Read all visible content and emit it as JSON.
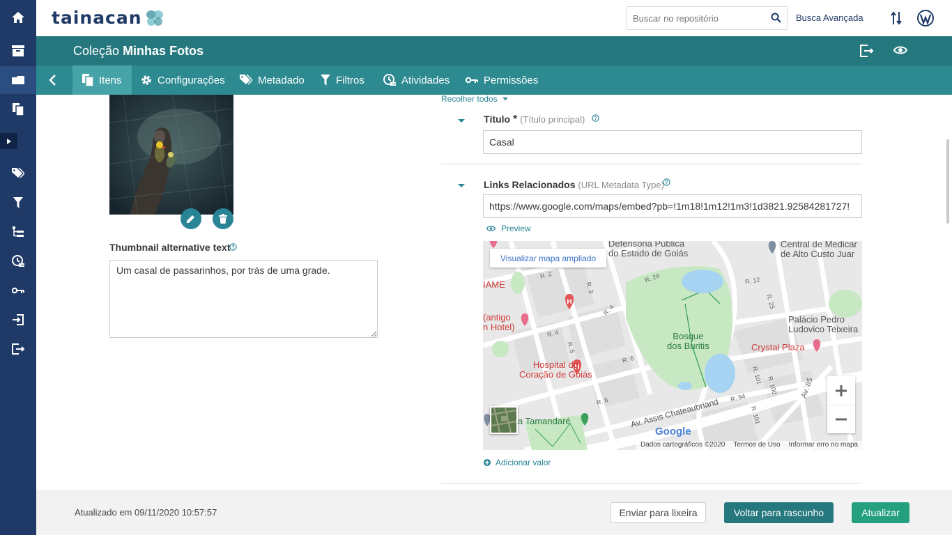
{
  "header": {
    "logo_text": "Tainacan",
    "search_placeholder": "Buscar no repositório",
    "advanced_search": "Busca Avançada"
  },
  "collection": {
    "prefix": "Coleção",
    "name": "Minhas Fotos"
  },
  "tabs": [
    {
      "label": "Itens",
      "icon": "items-icon",
      "active": true
    },
    {
      "label": "Configurações",
      "icon": "gear-icon",
      "active": false
    },
    {
      "label": "Metadado",
      "icon": "tag-icon",
      "active": false
    },
    {
      "label": "Filtros",
      "icon": "filter-icon",
      "active": false
    },
    {
      "label": "Atividades",
      "icon": "activity-icon",
      "active": false
    },
    {
      "label": "Permissões",
      "icon": "key-icon",
      "active": false
    }
  ],
  "sidebar_icons": [
    "home-icon",
    "archive-icon",
    "collections-icon",
    "items-icon",
    "expand-icon",
    "tag-icon",
    "filter-icon",
    "taxonomy-icon",
    "activity-icon",
    "key-icon",
    "import-icon",
    "export-icon"
  ],
  "thumbnail": {
    "alt_label": "Thumbnail alternative text",
    "alt_value": "Um casal de passarinhos, por trás de uma grade."
  },
  "form": {
    "collapse_all": "Recolher todos",
    "title_field": {
      "label": "Título",
      "required_mark": "*",
      "sub": "(Título principal)",
      "value": "Casal"
    },
    "links_field": {
      "label": "Links Relacionados",
      "sub": "(URL Metadata Type)",
      "value": "https://www.google.com/maps/embed?pb=!1m18!1m12!1m3!1d3821.92584281727!"
    },
    "preview": "Preview",
    "add_value": "Adicionar valor"
  },
  "map": {
    "enlarge": "Visualizar mapa ampliado",
    "labels": {
      "defensoria": "Defensoria Pública\ndo Estado de Goiás",
      "central": "Central de Medicar\nde Alto Custo Juar",
      "iame": "IAME",
      "antigo": "(antigo\nn Hotel)",
      "bosque": "Bosque\ndos Buritis",
      "palacio": "Palácio Pedro\nLudovico Teixeira",
      "crystal": "Crystal Plaza",
      "hospital": "Hospital do\nCoração de Goiás",
      "tamandare": "a Tamandaré",
      "avenue": "Av. Assis Chateaubriand"
    },
    "roads": [
      "R. 2",
      "R. 3",
      "R. 29",
      "R. 12",
      "R. 25",
      "R. 4",
      "R. 5",
      "R. 6",
      "R. 8",
      "R. 94",
      "R. 101",
      "R. 100",
      "Av. 85",
      "R. 4",
      "R. 101"
    ],
    "google": "Google",
    "footer": [
      "Dados cartográficos ©2020",
      "Termos de Uso",
      "Informar erro no mapa"
    ]
  },
  "footer": {
    "updated": "Atualizado em 09/11/2020 10:57:57",
    "trash": "Enviar para lixeira",
    "draft": "Voltar para rascunho",
    "update": "Atualizar"
  }
}
